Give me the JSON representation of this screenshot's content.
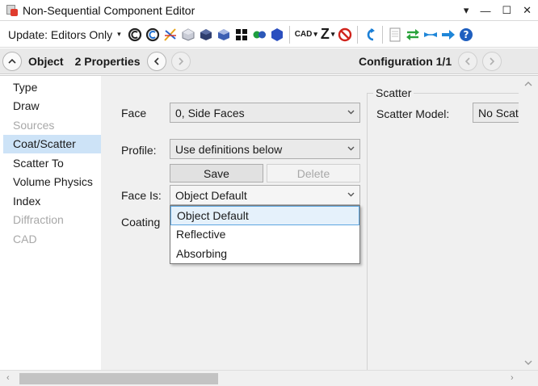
{
  "window": {
    "title": "Non-Sequential Component Editor",
    "controls": [
      "▾",
      "—",
      "☐",
      "✕"
    ]
  },
  "toolbar": {
    "update_label": "Update: Editors Only",
    "cad_label": "CAD",
    "z_label": "Z",
    "icons": [
      "refresh-c-icon",
      "refresh-c-alt-icon",
      "ray-trace-icon",
      "cube-outline-icon",
      "cube-solid-icon",
      "cube-blue-icon",
      "grid-squares-icon",
      "green-blue-dots-icon",
      "hexagon-icon",
      "cad-menu-icon",
      "z-menu-icon",
      "stop-icon",
      "undo-arrow-icon",
      "document-icon",
      "swap-arrows-icon",
      "arrows-converge-icon",
      "arrow-right-icon",
      "help-icon"
    ]
  },
  "navrow": {
    "object_label": "Object",
    "properties_label": "2 Properties",
    "configuration_label": "Configuration 1/1"
  },
  "sidebar": {
    "items": [
      {
        "label": "Type",
        "state": "normal"
      },
      {
        "label": "Draw",
        "state": "normal"
      },
      {
        "label": "Sources",
        "state": "disabled"
      },
      {
        "label": "Coat/Scatter",
        "state": "selected"
      },
      {
        "label": "Scatter To",
        "state": "normal"
      },
      {
        "label": "Volume Physics",
        "state": "normal"
      },
      {
        "label": "Index",
        "state": "normal"
      },
      {
        "label": "Diffraction",
        "state": "disabled"
      },
      {
        "label": "CAD",
        "state": "disabled"
      }
    ]
  },
  "form": {
    "face_label": "Face",
    "face_value": "0, Side Faces",
    "profile_label": "Profile:",
    "profile_value": "Use definitions below",
    "save_label": "Save",
    "delete_label": "Delete",
    "face_is_label": "Face Is:",
    "face_is_value": "Object Default",
    "coating_label": "Coating",
    "face_is_options": [
      "Object Default",
      "Reflective",
      "Absorbing"
    ],
    "face_is_highlighted_index": 0
  },
  "scatter": {
    "group_title": "Scatter",
    "model_label": "Scatter Model:",
    "model_value": "No Scatt"
  },
  "colors": {
    "selection": "#cde3f7",
    "panel_bg": "#f0f0f0",
    "highlight_border": "#5ea6e0"
  }
}
